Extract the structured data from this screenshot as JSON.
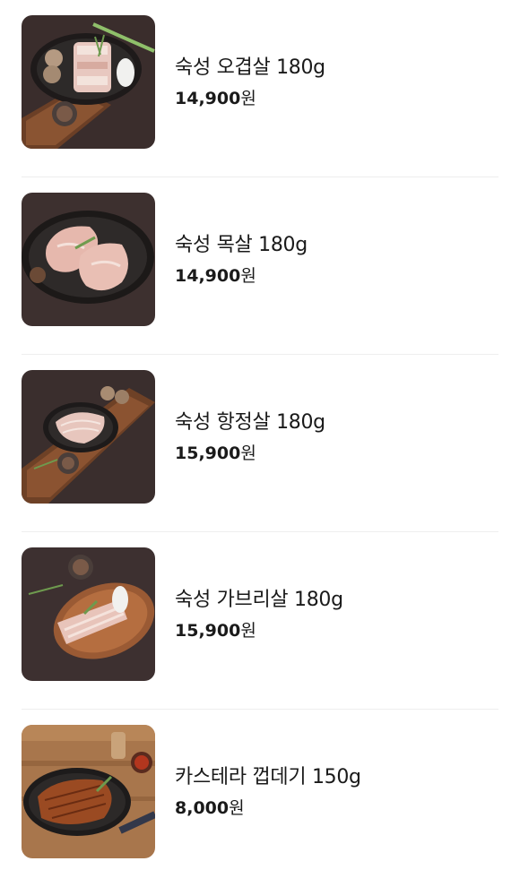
{
  "products": [
    {
      "name": "숙성 오겹살 180g",
      "price": "14,900",
      "currency": "원",
      "image_icon": "pork-belly-thumbnail"
    },
    {
      "name": "숙성 목살 180g",
      "price": "14,900",
      "currency": "원",
      "image_icon": "pork-neck-thumbnail"
    },
    {
      "name": "숙성 항정살 180g",
      "price": "15,900",
      "currency": "원",
      "image_icon": "pork-jowl-thumbnail"
    },
    {
      "name": "숙성 가브리살 180g",
      "price": "15,900",
      "currency": "원",
      "image_icon": "pork-shoulder-thumbnail"
    },
    {
      "name": "카스테라 껍데기 150g",
      "price": "8,000",
      "currency": "원",
      "image_icon": "pork-skin-thumbnail"
    }
  ],
  "colors": {
    "background": "#ffffff",
    "text": "#1a1a1a",
    "divider": "#eeeeee",
    "photo_dark": "#3b2f2f",
    "photo_wood": "#9a6a45"
  }
}
